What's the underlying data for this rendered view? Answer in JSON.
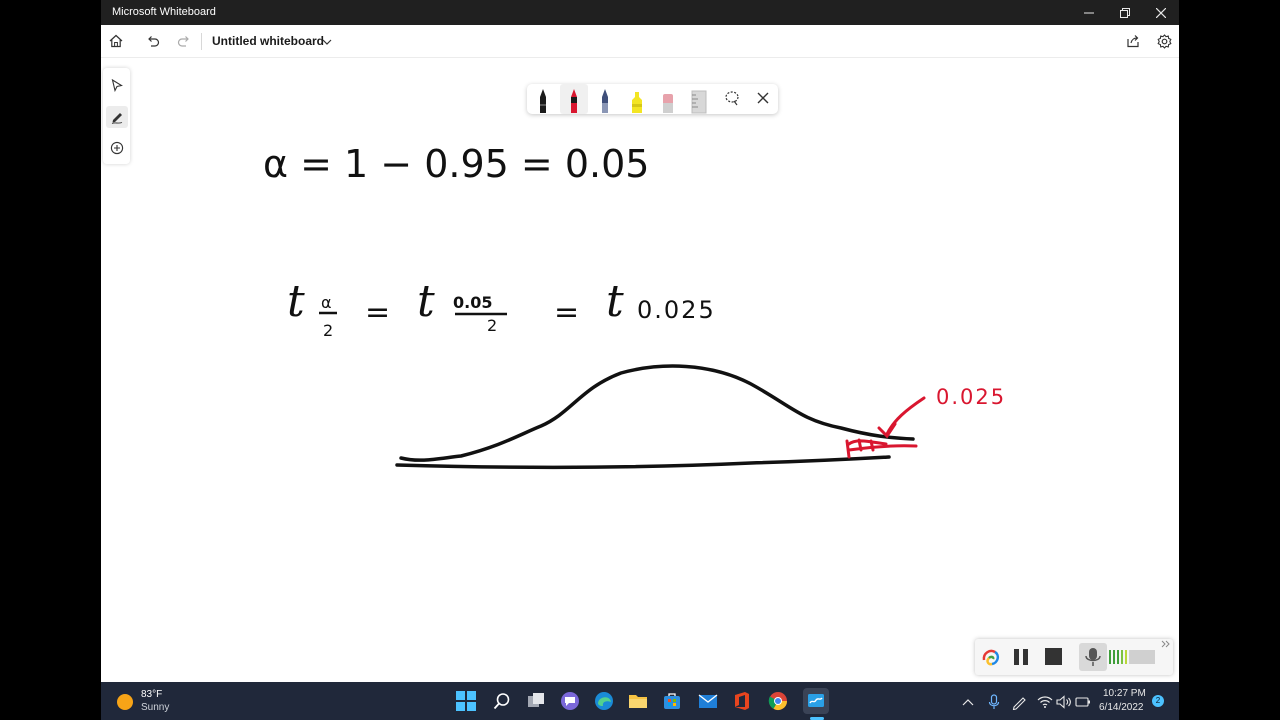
{
  "window": {
    "title": "Microsoft Whiteboard"
  },
  "appbar": {
    "board_title": "Untitled whiteboard"
  },
  "board": {
    "line1": "α = 1 − 0.95 = 0.05",
    "line2_t": "t",
    "line2_sub_num": "α",
    "line2_sub_den": "2",
    "line2_eq1": "=",
    "line2_t2": "t",
    "line2_sub2_num": "0.05",
    "line2_sub2_den": "2",
    "line2_eq2": "=",
    "line2_t3": "t",
    "line2_sub3": "0.025",
    "annotation": "0.025"
  },
  "colors": {
    "ink_black": "#111111",
    "ink_red": "#d9162f",
    "taskbar": "#20283a",
    "titlebar": "#202020"
  },
  "taskbar": {
    "weather_temp": "83°F",
    "weather_desc": "Sunny",
    "time": "10:27 PM",
    "date": "6/14/2022",
    "notification_count": "2"
  }
}
